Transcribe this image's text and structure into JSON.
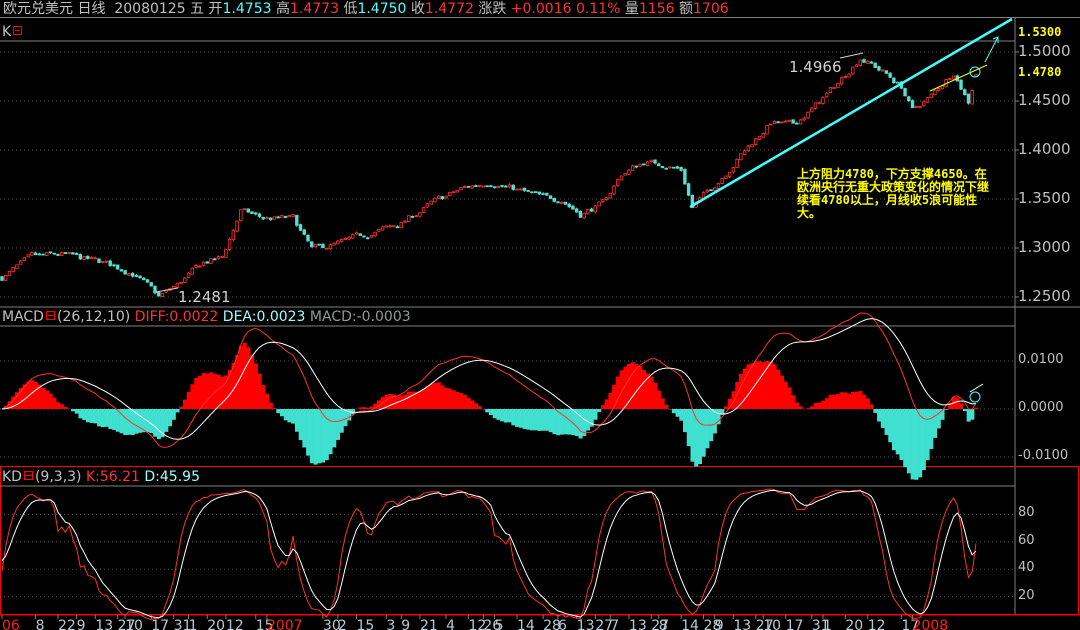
{
  "header": {
    "symbol": "欧元兑美元",
    "period": "日线",
    "date": "20080125",
    "weekday": "五",
    "open_label": "开",
    "open": "1.4753",
    "high_label": "高",
    "high": "1.4773",
    "low_label": "低",
    "low": "1.4750",
    "close_label": "收",
    "close": "1.4772",
    "change_label": "涨跌",
    "change": "+0.0016",
    "change_pct": "0.11%",
    "volume_label": "量",
    "volume": "1156",
    "amount_label": "额",
    "amount": "1706"
  },
  "panels": {
    "k": {
      "label": "K"
    },
    "macd": {
      "label": "MACD",
      "params": "(26,12,10)",
      "diff": "DIFF:0.0022",
      "dea": "DEA:0.0023",
      "macd": "MACD:-0.0003"
    },
    "kd": {
      "label": "KD",
      "params": "(9,3,3)",
      "k": "K:56.21",
      "d": "D:45.95"
    }
  },
  "annotations": {
    "high_mark": "1.4966",
    "low_mark": "1.2481",
    "target": "1.5300",
    "resistance": "1.4780",
    "note": "上方阻力4780，下方支撑4650。在欧洲央行无重大政策变化的情况下继续看4780以上，月线收5浪可能性大。"
  },
  "colors": {
    "up": "#ff3232",
    "down": "#54e0d0",
    "trend": "#40ffff",
    "yellow": "#ffff00",
    "grid": "#555555"
  },
  "chart_data": [
    {
      "type": "candlestick",
      "title": "欧元兑美元 日线",
      "n_bars": 262,
      "anchors": [
        [
          0,
          1.27
        ],
        [
          8,
          1.29
        ],
        [
          16,
          1.293
        ],
        [
          27,
          1.285
        ],
        [
          35,
          1.275
        ],
        [
          42,
          1.25
        ],
        [
          47,
          1.262
        ],
        [
          54,
          1.285
        ],
        [
          59,
          1.29
        ],
        [
          64,
          1.338
        ],
        [
          70,
          1.33
        ],
        [
          78,
          1.33
        ],
        [
          83,
          1.298
        ],
        [
          91,
          1.305
        ],
        [
          99,
          1.315
        ],
        [
          107,
          1.325
        ],
        [
          115,
          1.345
        ],
        [
          123,
          1.36
        ],
        [
          131,
          1.368
        ],
        [
          139,
          1.358
        ],
        [
          146,
          1.35
        ],
        [
          150,
          1.35
        ],
        [
          155,
          1.335
        ],
        [
          161,
          1.345
        ],
        [
          166,
          1.375
        ],
        [
          172,
          1.388
        ],
        [
          178,
          1.385
        ],
        [
          182,
          1.38
        ],
        [
          185,
          1.342
        ],
        [
          190,
          1.36
        ],
        [
          198,
          1.395
        ],
        [
          206,
          1.428
        ],
        [
          212,
          1.425
        ],
        [
          218,
          1.445
        ],
        [
          224,
          1.468
        ],
        [
          230,
          1.495
        ],
        [
          236,
          1.48
        ],
        [
          241,
          1.465
        ],
        [
          244,
          1.44
        ],
        [
          249,
          1.455
        ],
        [
          255,
          1.48
        ],
        [
          257,
          1.465
        ],
        [
          259,
          1.45
        ],
        [
          261,
          1.477
        ]
      ],
      "ylim": [
        1.23,
        1.53
      ],
      "yticks": [
        "1.5000",
        "1.4500",
        "1.4000",
        "1.3500",
        "1.3000",
        "1.2500"
      ],
      "ytick_values": [
        1.5,
        1.45,
        1.4,
        1.35,
        1.3,
        1.25
      ]
    },
    {
      "type": "macd",
      "params": [
        26,
        12,
        10
      ],
      "ylim": [
        -0.0115,
        0.017
      ],
      "yticks": [
        "0.0100",
        "0.0000",
        "-0.0100"
      ],
      "ytick_values": [
        0.01,
        0,
        -0.01
      ]
    },
    {
      "type": "kd",
      "params": [
        9,
        3,
        3
      ],
      "ylim": [
        0,
        100
      ],
      "yticks": [
        "80",
        "60",
        "40",
        "20"
      ],
      "ytick_values": [
        80,
        60,
        40,
        20
      ]
    }
  ],
  "xaxis": [
    {
      "label": "06",
      "i": 0,
      "year": true
    },
    {
      "label": "8",
      "i": 9
    },
    {
      "label": "22",
      "i": 15
    },
    {
      "label": "9",
      "i": 20
    },
    {
      "label": "13",
      "i": 25
    },
    {
      "label": "27",
      "i": 31
    },
    {
      "label": "10",
      "i": 33
    },
    {
      "label": "17",
      "i": 40
    },
    {
      "label": "31",
      "i": 46
    },
    {
      "label": "1",
      "i": 50
    },
    {
      "label": "20",
      "i": 55
    },
    {
      "label": "12",
      "i": 60
    },
    {
      "label": "15",
      "i": 68
    },
    {
      "label": "2007",
      "i": 71,
      "year": true
    },
    {
      "label": "30",
      "i": 86
    },
    {
      "label": "2",
      "i": 90
    },
    {
      "label": "15",
      "i": 95
    },
    {
      "label": "3",
      "i": 103
    },
    {
      "label": "9",
      "i": 107
    },
    {
      "label": "21",
      "i": 112
    },
    {
      "label": "4",
      "i": 119
    },
    {
      "label": "12",
      "i": 125
    },
    {
      "label": "26",
      "i": 129
    },
    {
      "label": "5",
      "i": 132
    },
    {
      "label": "14",
      "i": 138
    },
    {
      "label": "28",
      "i": 145
    },
    {
      "label": "6",
      "i": 149
    },
    {
      "label": "13",
      "i": 154
    },
    {
      "label": "27",
      "i": 159
    },
    {
      "label": "7",
      "i": 163
    },
    {
      "label": "13",
      "i": 168
    },
    {
      "label": "27",
      "i": 174
    },
    {
      "label": "8",
      "i": 176
    },
    {
      "label": "14",
      "i": 182
    },
    {
      "label": "28",
      "i": 188
    },
    {
      "label": "9",
      "i": 191
    },
    {
      "label": "13",
      "i": 196
    },
    {
      "label": "27",
      "i": 202
    },
    {
      "label": "10",
      "i": 204
    },
    {
      "label": "17",
      "i": 210
    },
    {
      "label": "31",
      "i": 217
    },
    {
      "label": "1",
      "i": 220
    },
    {
      "label": "20",
      "i": 226
    },
    {
      "label": "12",
      "i": 232
    },
    {
      "label": "17",
      "i": 241
    },
    {
      "label": "2008",
      "i": 244,
      "year": true
    }
  ]
}
